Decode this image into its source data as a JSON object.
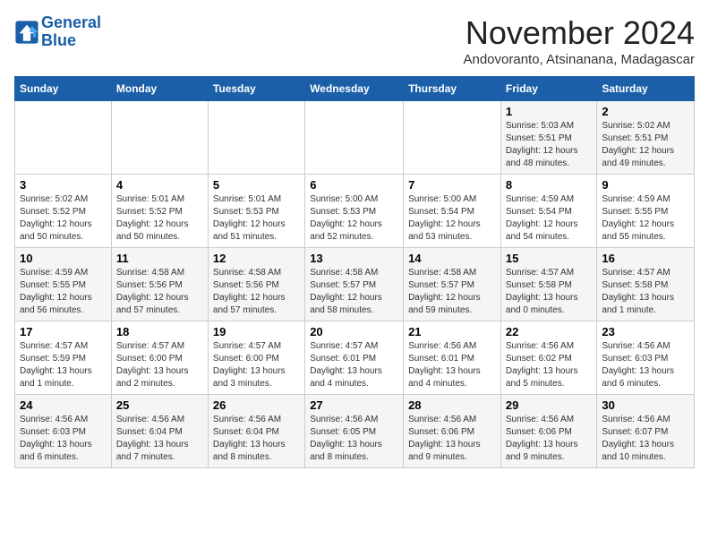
{
  "logo": {
    "line1": "General",
    "line2": "Blue"
  },
  "title": "November 2024",
  "location": "Andovoranto, Atsinanana, Madagascar",
  "weekdays": [
    "Sunday",
    "Monday",
    "Tuesday",
    "Wednesday",
    "Thursday",
    "Friday",
    "Saturday"
  ],
  "weeks": [
    [
      {
        "day": "",
        "info": ""
      },
      {
        "day": "",
        "info": ""
      },
      {
        "day": "",
        "info": ""
      },
      {
        "day": "",
        "info": ""
      },
      {
        "day": "",
        "info": ""
      },
      {
        "day": "1",
        "info": "Sunrise: 5:03 AM\nSunset: 5:51 PM\nDaylight: 12 hours\nand 48 minutes."
      },
      {
        "day": "2",
        "info": "Sunrise: 5:02 AM\nSunset: 5:51 PM\nDaylight: 12 hours\nand 49 minutes."
      }
    ],
    [
      {
        "day": "3",
        "info": "Sunrise: 5:02 AM\nSunset: 5:52 PM\nDaylight: 12 hours\nand 50 minutes."
      },
      {
        "day": "4",
        "info": "Sunrise: 5:01 AM\nSunset: 5:52 PM\nDaylight: 12 hours\nand 50 minutes."
      },
      {
        "day": "5",
        "info": "Sunrise: 5:01 AM\nSunset: 5:53 PM\nDaylight: 12 hours\nand 51 minutes."
      },
      {
        "day": "6",
        "info": "Sunrise: 5:00 AM\nSunset: 5:53 PM\nDaylight: 12 hours\nand 52 minutes."
      },
      {
        "day": "7",
        "info": "Sunrise: 5:00 AM\nSunset: 5:54 PM\nDaylight: 12 hours\nand 53 minutes."
      },
      {
        "day": "8",
        "info": "Sunrise: 4:59 AM\nSunset: 5:54 PM\nDaylight: 12 hours\nand 54 minutes."
      },
      {
        "day": "9",
        "info": "Sunrise: 4:59 AM\nSunset: 5:55 PM\nDaylight: 12 hours\nand 55 minutes."
      }
    ],
    [
      {
        "day": "10",
        "info": "Sunrise: 4:59 AM\nSunset: 5:55 PM\nDaylight: 12 hours\nand 56 minutes."
      },
      {
        "day": "11",
        "info": "Sunrise: 4:58 AM\nSunset: 5:56 PM\nDaylight: 12 hours\nand 57 minutes."
      },
      {
        "day": "12",
        "info": "Sunrise: 4:58 AM\nSunset: 5:56 PM\nDaylight: 12 hours\nand 57 minutes."
      },
      {
        "day": "13",
        "info": "Sunrise: 4:58 AM\nSunset: 5:57 PM\nDaylight: 12 hours\nand 58 minutes."
      },
      {
        "day": "14",
        "info": "Sunrise: 4:58 AM\nSunset: 5:57 PM\nDaylight: 12 hours\nand 59 minutes."
      },
      {
        "day": "15",
        "info": "Sunrise: 4:57 AM\nSunset: 5:58 PM\nDaylight: 13 hours\nand 0 minutes."
      },
      {
        "day": "16",
        "info": "Sunrise: 4:57 AM\nSunset: 5:58 PM\nDaylight: 13 hours\nand 1 minute."
      }
    ],
    [
      {
        "day": "17",
        "info": "Sunrise: 4:57 AM\nSunset: 5:59 PM\nDaylight: 13 hours\nand 1 minute."
      },
      {
        "day": "18",
        "info": "Sunrise: 4:57 AM\nSunset: 6:00 PM\nDaylight: 13 hours\nand 2 minutes."
      },
      {
        "day": "19",
        "info": "Sunrise: 4:57 AM\nSunset: 6:00 PM\nDaylight: 13 hours\nand 3 minutes."
      },
      {
        "day": "20",
        "info": "Sunrise: 4:57 AM\nSunset: 6:01 PM\nDaylight: 13 hours\nand 4 minutes."
      },
      {
        "day": "21",
        "info": "Sunrise: 4:56 AM\nSunset: 6:01 PM\nDaylight: 13 hours\nand 4 minutes."
      },
      {
        "day": "22",
        "info": "Sunrise: 4:56 AM\nSunset: 6:02 PM\nDaylight: 13 hours\nand 5 minutes."
      },
      {
        "day": "23",
        "info": "Sunrise: 4:56 AM\nSunset: 6:03 PM\nDaylight: 13 hours\nand 6 minutes."
      }
    ],
    [
      {
        "day": "24",
        "info": "Sunrise: 4:56 AM\nSunset: 6:03 PM\nDaylight: 13 hours\nand 6 minutes."
      },
      {
        "day": "25",
        "info": "Sunrise: 4:56 AM\nSunset: 6:04 PM\nDaylight: 13 hours\nand 7 minutes."
      },
      {
        "day": "26",
        "info": "Sunrise: 4:56 AM\nSunset: 6:04 PM\nDaylight: 13 hours\nand 8 minutes."
      },
      {
        "day": "27",
        "info": "Sunrise: 4:56 AM\nSunset: 6:05 PM\nDaylight: 13 hours\nand 8 minutes."
      },
      {
        "day": "28",
        "info": "Sunrise: 4:56 AM\nSunset: 6:06 PM\nDaylight: 13 hours\nand 9 minutes."
      },
      {
        "day": "29",
        "info": "Sunrise: 4:56 AM\nSunset: 6:06 PM\nDaylight: 13 hours\nand 9 minutes."
      },
      {
        "day": "30",
        "info": "Sunrise: 4:56 AM\nSunset: 6:07 PM\nDaylight: 13 hours\nand 10 minutes."
      }
    ]
  ]
}
